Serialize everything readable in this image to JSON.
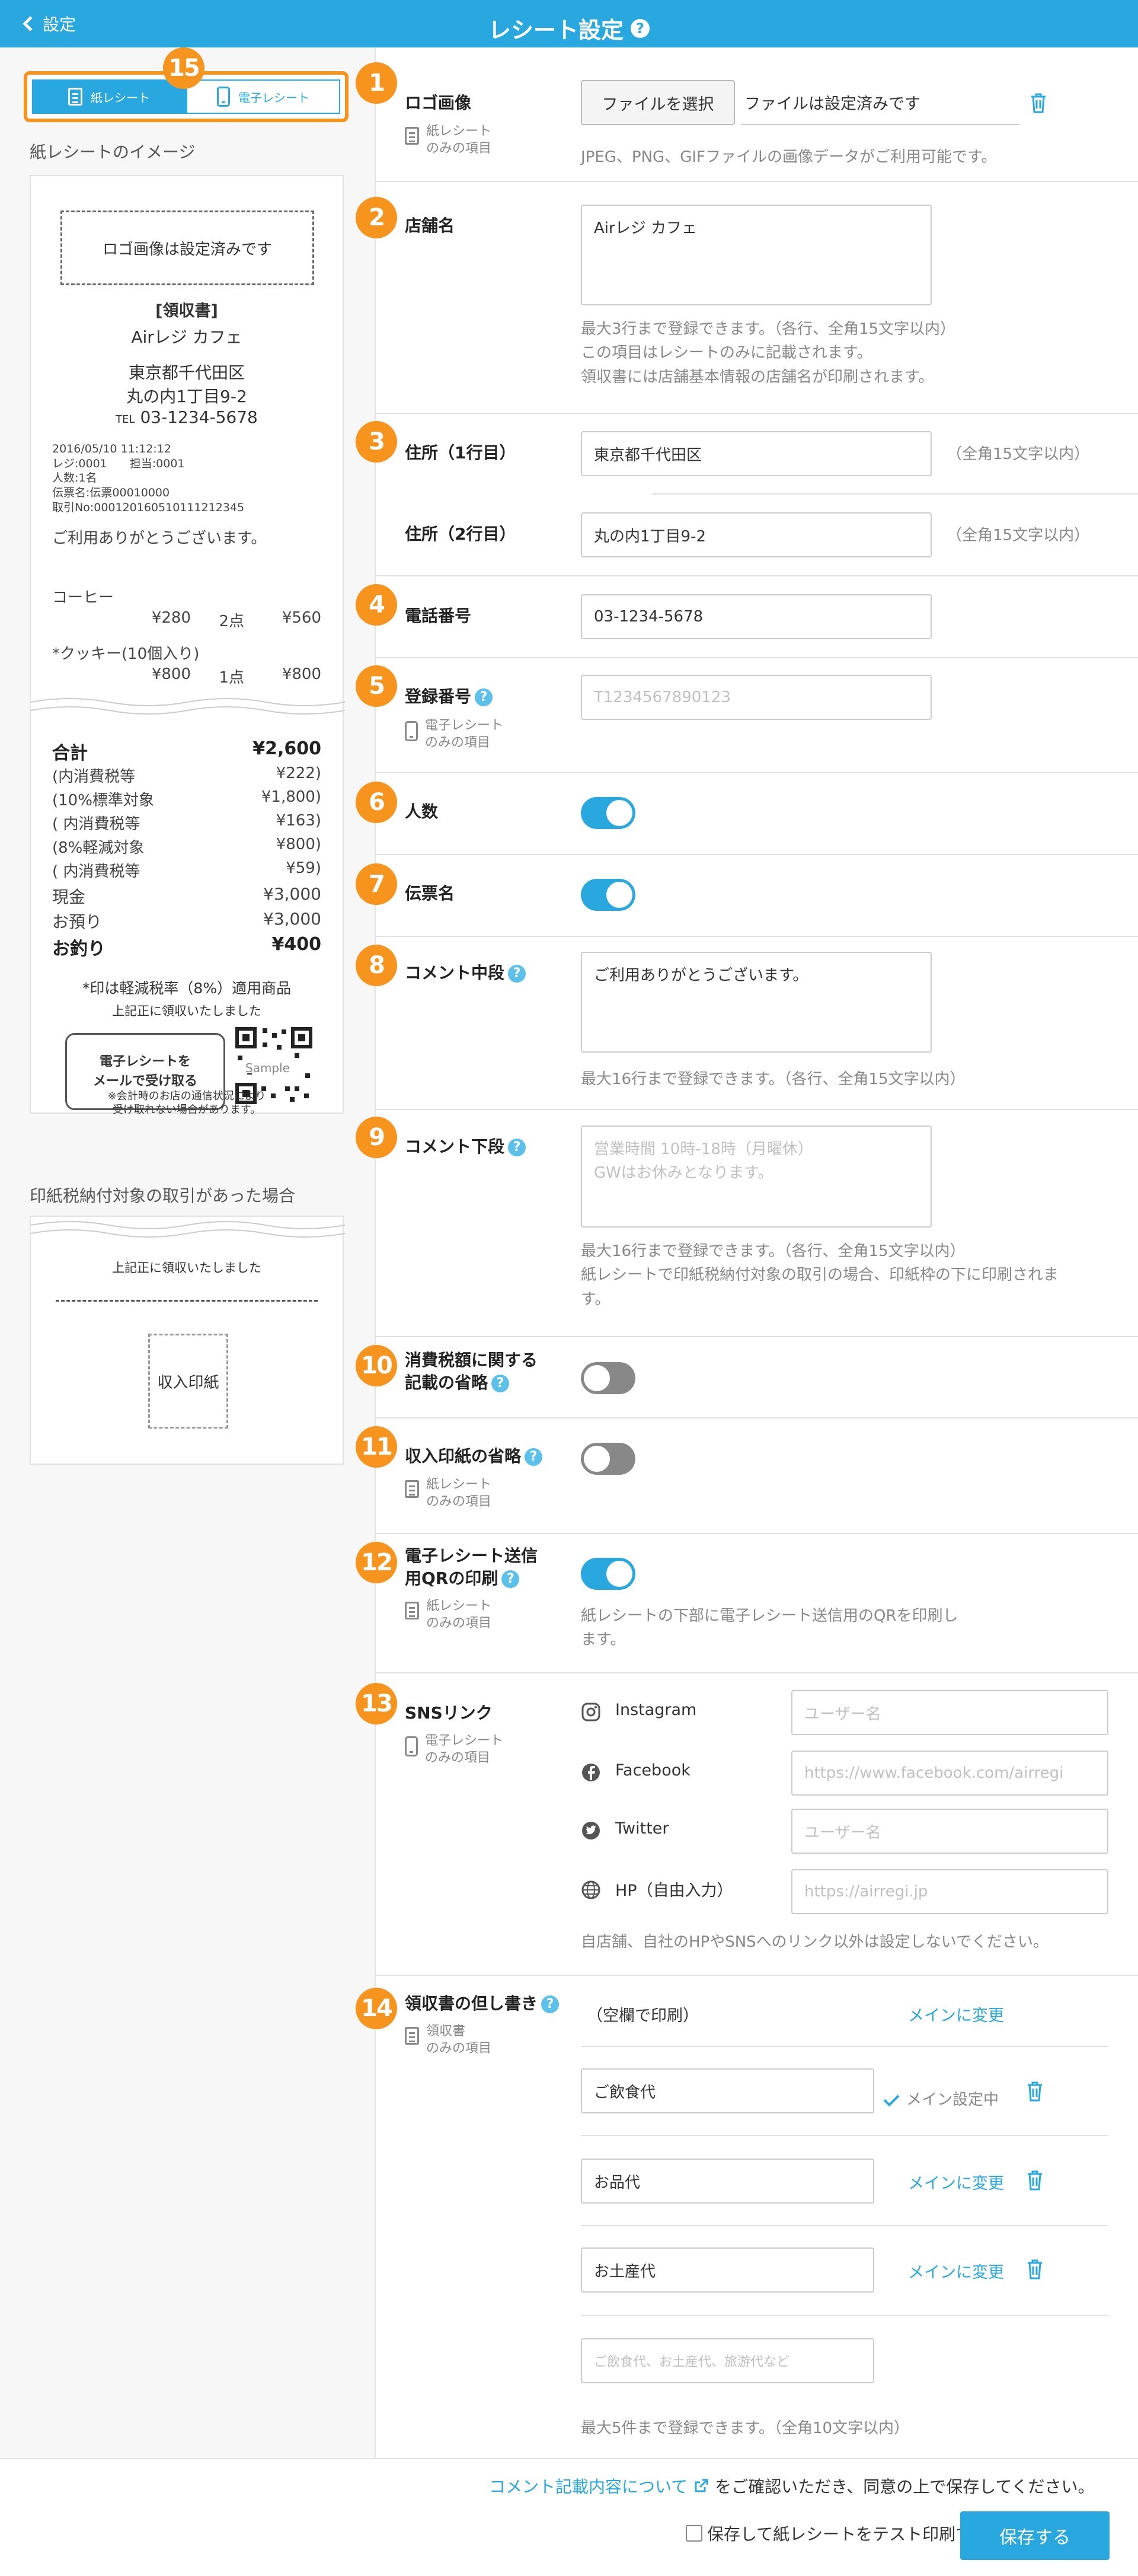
{
  "header": {
    "back_label": "設定",
    "title": "レシート設定"
  },
  "left": {
    "tab_paper": "紙レシート",
    "tab_digital": "電子レシート",
    "preview_title": "紙レシートのイメージ",
    "stamp_title": "印紙税納付対象の取引があった場合",
    "receipt": {
      "logo_placeholder": "ロゴ画像は設定済みです",
      "heading": "[領収書]",
      "store": "Airレジ カフェ",
      "addr1": "東京都千代田区",
      "addr2": "丸の内1丁目9-2",
      "tel_prefix": "TEL",
      "tel": "03-1234-5678",
      "meta": [
        "2016/05/10 11:12:12",
        "レジ:0001　　担当:0001",
        "人数:1名",
        "伝票名:伝票00010000",
        "取引No:00012016051011121234​5"
      ],
      "thanks": "ご利用ありがとうございます。",
      "items": [
        {
          "name": "コーヒー",
          "price": "¥280",
          "qty": "2点",
          "sum": "¥560"
        },
        {
          "name": "*クッキー(10個入り)",
          "price": "¥800",
          "qty": "1点",
          "sum": "¥800"
        }
      ],
      "totals": [
        {
          "k": "合計",
          "v": "¥2,600",
          "bold": true
        },
        {
          "k": "(内消費税等",
          "v": "¥222)"
        },
        {
          "k": "(10%標準対象",
          "v": "¥1,800)"
        },
        {
          "k": "( 内消費税等",
          "v": "¥163)"
        },
        {
          "k": "(8%軽減対象",
          "v": "¥800)"
        },
        {
          "k": "( 内消費税等",
          "v": "¥59)"
        },
        {
          "k": "現金",
          "v": "¥3,000"
        },
        {
          "k": "お預り",
          "v": "¥3,000"
        },
        {
          "k": "お釣り",
          "v": "¥400",
          "bold": true
        }
      ],
      "reduced_note": "*印は軽減税率（8%）適用商品",
      "received": "上記正に領収いたしました",
      "bubble_l1": "電子レシートを",
      "bubble_l2": "メールで受け取る",
      "qr_label": "Sample",
      "footnote1": "※会計時のお店の通信状況により",
      "footnote2": "受け取れない場合があります。"
    },
    "stamp": {
      "received": "上記正に領収いたしました",
      "box": "収入印紙"
    }
  },
  "badges": [
    "1",
    "2",
    "3",
    "4",
    "5",
    "6",
    "7",
    "8",
    "9",
    "10",
    "11",
    "12",
    "13",
    "14",
    "15"
  ],
  "notes": {
    "paper_only_1": "紙レシート",
    "paper_only_2": "のみの項目",
    "digital_only_1": "電子レシート",
    "digital_only_2": "のみの項目",
    "receipt_only_1": "領収書",
    "receipt_only_2": "のみの項目"
  },
  "fields": {
    "logo": {
      "label": "ロゴ画像",
      "button": "ファイルを選択",
      "file": "ファイルは設定済みです",
      "help": "JPEG、PNG、GIFファイルの画像データがご利用可能です。"
    },
    "store": {
      "label": "店舗名",
      "value": "Airレジ カフェ",
      "help1": "最大3行まで登録できます。（各行、全角15文字以内）",
      "help2": "この項目はレシートのみに記載されます。",
      "help3": "領収書には店舗基本情報の店舗名が印刷されます。"
    },
    "addr1": {
      "label": "住所（1行目）",
      "value": "東京都千代田区",
      "side": "（全角15文字以内）"
    },
    "addr2": {
      "label": "住所（2行目）",
      "value": "丸の内1丁目9-2",
      "side": "（全角15文字以内）"
    },
    "phone": {
      "label": "電話番号",
      "value": "03-1234-5678"
    },
    "reg": {
      "label": "登録番号",
      "placeholder": "T1234567890123"
    },
    "people": {
      "label": "人数",
      "on": true
    },
    "slip": {
      "label": "伝票名",
      "on": true
    },
    "comment_mid": {
      "label": "コメント中段",
      "value": "ご利用ありがとうございます。",
      "help": "最大16行まで登録できます。（各行、全角15文字以内）"
    },
    "comment_low": {
      "label": "コメント下段",
      "ph1": "営業時間 10時-18時（月曜休）",
      "ph2": "GWはお休みとなります。",
      "help1": "最大16行まで登録できます。（各行、全角15文字以内）",
      "help2": "紙レシートで印紙税納付対象の取引の場合、印紙枠の下に印刷されま",
      "help3": "す。"
    },
    "tax_omit": {
      "label1": "消費税額に関する",
      "label2": "記載の省略",
      "on": false
    },
    "stamp_omit": {
      "label": "収入印紙の省略",
      "on": false
    },
    "qr": {
      "label1": "電子レシート送信",
      "label2": "用QRの印刷",
      "on": true,
      "help1": "紙レシートの下部に電子レシート送信用のQRを印刷し",
      "help2": "ます。"
    },
    "sns": {
      "label": "SNSリンク",
      "items": [
        {
          "name": "Instagram",
          "placeholder": "ユーザー名"
        },
        {
          "name": "Facebook",
          "placeholder": "https://www.facebook.com/airregi"
        },
        {
          "name": "Twitter",
          "placeholder": "ユーザー名"
        },
        {
          "name": "HP（自由入力）",
          "placeholder": "https://airregi.jp"
        }
      ],
      "help": "自店舗、自社のHPやSNSへのリンク以外は設定しないでください。"
    },
    "proviso": {
      "label": "領収書の但し書き",
      "blank": "（空欄で印刷）",
      "make_main": "メインに変更",
      "main_set": "メイン設定中",
      "items": [
        {
          "value": "ご飲食代"
        },
        {
          "value": "お品代"
        },
        {
          "value": "お土産代"
        }
      ],
      "placeholder": "ご飲食代、お土産代、旅游代など",
      "help": "最大5件まで登録できます。（全角10文字以内）"
    }
  },
  "footer": {
    "link": "コメント記載内容について",
    "after": "をご確認いただき、同意の上で保存してください。",
    "checkbox": "保存して紙レシートをテスト印刷する",
    "save": "保存する"
  }
}
